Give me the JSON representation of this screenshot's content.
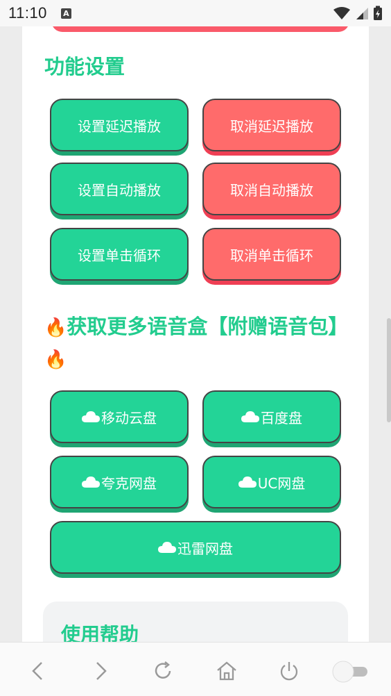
{
  "status_bar": {
    "time": "11:10",
    "notif_badge": "A"
  },
  "sections": {
    "settings_title": "功能设置",
    "more_title": "获取更多语音盒【附赠语音包】",
    "help_title": "使用帮助"
  },
  "settings_buttons": [
    {
      "label": "设置延迟播放",
      "color": "#23d497"
    },
    {
      "label": "取消延迟播放",
      "color": "#ff6b6b"
    },
    {
      "label": "设置自动播放",
      "color": "#23d497"
    },
    {
      "label": "取消自动播放",
      "color": "#ff6b6b"
    },
    {
      "label": "设置单击循环",
      "color": "#23d497"
    },
    {
      "label": "取消单击循环",
      "color": "#ff6b6b"
    }
  ],
  "download_buttons": [
    {
      "label": "移动云盘"
    },
    {
      "label": "百度盘"
    },
    {
      "label": "夸克网盘"
    },
    {
      "label": "UC网盘"
    },
    {
      "label": "迅雷网盘"
    }
  ],
  "icons": {
    "fire": "fire-icon",
    "cloud": "cloud-icon"
  },
  "colors": {
    "accent_green": "#22cc8e",
    "button_green": "#23d497",
    "button_red": "#ff6b6b"
  }
}
